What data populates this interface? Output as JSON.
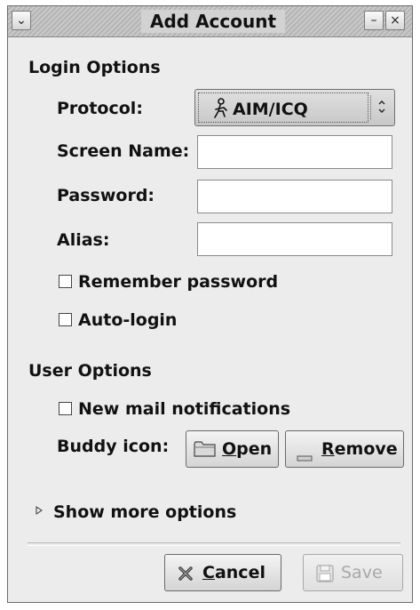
{
  "window": {
    "title": "Add Account",
    "menu_glyph": "⌄",
    "minimize_glyph": "–",
    "close_glyph": "×"
  },
  "login_options": {
    "heading": "Login Options",
    "protocol_label": "Protocol:",
    "protocol_value": "AIM/ICQ",
    "protocol_icon": "aim-running-man-icon",
    "screen_name_label": "Screen Name:",
    "screen_name_value": "",
    "password_label": "Password:",
    "password_value": "",
    "alias_label": "Alias:",
    "alias_value": "",
    "remember_password_label": "Remember password",
    "remember_password_checked": false,
    "auto_login_label": "Auto-login",
    "auto_login_checked": false
  },
  "user_options": {
    "heading": "User Options",
    "new_mail_label": "New mail notifications",
    "new_mail_checked": false,
    "buddy_icon_label": "Buddy icon:",
    "open_button": {
      "mnemonic": "O",
      "rest": "pen"
    },
    "remove_button": {
      "mnemonic": "R",
      "rest": "emove"
    }
  },
  "expander": {
    "label": "Show more options",
    "expanded": false
  },
  "footer": {
    "cancel_button": {
      "mnemonic": "C",
      "rest": "ancel"
    },
    "save_button": {
      "label": "Save",
      "enabled": false
    }
  }
}
